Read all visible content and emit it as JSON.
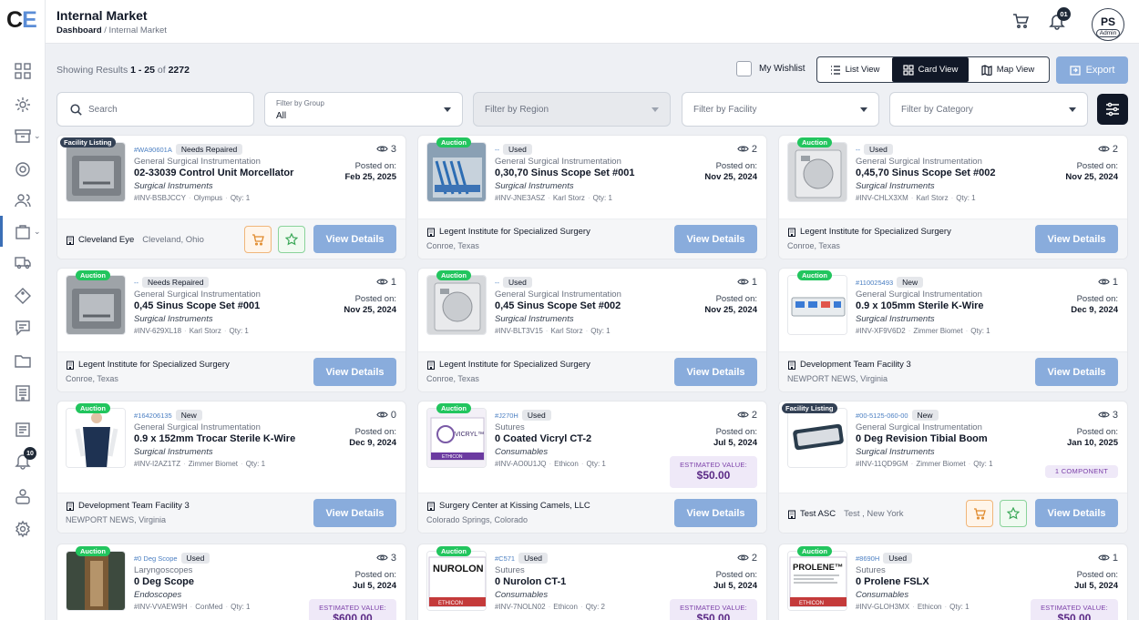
{
  "app": {
    "logo_c": "C",
    "logo_e": "E"
  },
  "header": {
    "title": "Internal Market",
    "breadcrumb_root": "Dashboard",
    "breadcrumb_sep": " / ",
    "breadcrumb_current": "Internal Market",
    "notifications": "01",
    "avatar_initials": "PS",
    "avatar_role": "Admin"
  },
  "sidebar": {
    "notification_badge": "10"
  },
  "toolbar": {
    "results_prefix": "Showing Results ",
    "results_range": "1 - 25",
    "results_of": " of ",
    "results_total": "2272",
    "wishlist_label": "My Wishlist",
    "views": [
      "List View",
      "Card View",
      "Map View"
    ],
    "active_view": "Card View",
    "export_label": "Export"
  },
  "filters": {
    "search_placeholder": "Search",
    "group_label": "Filter by Group",
    "group_value": "All",
    "region": "Filter by Region",
    "facility": "Filter by Facility",
    "category": "Filter by Category"
  },
  "labels": {
    "posted_on": "Posted on:",
    "view_details": "View Details",
    "estimated_value": "ESTIMATED VALUE:",
    "component": "1 COMPONENT",
    "qty_prefix": "Qty: "
  },
  "cards": [
    {
      "badge": "Facility Listing",
      "badge_type": "listing",
      "id": "#WA90601A",
      "condition": "Needs Repaired",
      "views": "3",
      "group": "General Surgical Instrumentation",
      "title": "02-33039 Control Unit Morcellator",
      "category": "Surgical Instruments",
      "inv": "#INV-BSBJCCY",
      "maker": "Olympus",
      "qty": "1",
      "posted": "Feb 25, 2025",
      "facility": "Cleveland Eye",
      "location": "Cleveland, Ohio",
      "location_inline": true,
      "actions": true,
      "thumb": "grey"
    },
    {
      "badge": "Auction",
      "badge_type": "auction",
      "id": "--",
      "condition": "Used",
      "views": "2",
      "group": "General Surgical Instrumentation",
      "title": "0,30,70 Sinus Scope Set #001",
      "category": "Surgical Instruments",
      "inv": "#INV-JNE3ASZ",
      "maker": "Karl Storz",
      "qty": "1",
      "posted": "Nov 25, 2024",
      "facility": "Legent Institute for Specialized Surgery",
      "location": "Conroe, Texas",
      "thumb": "blue"
    },
    {
      "badge": "Auction",
      "badge_type": "auction",
      "id": "--",
      "condition": "Used",
      "views": "2",
      "group": "General Surgical Instrumentation",
      "title": "0,45,70 Sinus Scope Set #002",
      "category": "Surgical Instruments",
      "inv": "#INV-CHLX3XM",
      "maker": "Karl Storz",
      "qty": "1",
      "posted": "Nov 25, 2024",
      "facility": "Legent Institute for Specialized Surgery",
      "location": "Conroe, Texas",
      "thumb": "silver"
    },
    {
      "badge": "Auction",
      "badge_type": "auction",
      "id": "--",
      "condition": "Needs Repaired",
      "views": "1",
      "group": "General Surgical Instrumentation",
      "title": "0,45 Sinus Scope Set #001",
      "category": "Surgical Instruments",
      "inv": "#INV-629XL18",
      "maker": "Karl Storz",
      "qty": "1",
      "posted": "Nov 25, 2024",
      "facility": "Legent Institute for Specialized Surgery",
      "location": "Conroe, Texas",
      "thumb": "grey"
    },
    {
      "badge": "Auction",
      "badge_type": "auction",
      "id": "--",
      "condition": "Used",
      "views": "1",
      "group": "General Surgical Instrumentation",
      "title": "0,45 Sinus Scope Set #002",
      "category": "Surgical Instruments",
      "inv": "#INV-BLT3V15",
      "maker": "Karl Storz",
      "qty": "1",
      "posted": "Nov 25, 2024",
      "facility": "Legent Institute for Specialized Surgery",
      "location": "Conroe, Texas",
      "thumb": "silver"
    },
    {
      "badge": "Auction",
      "badge_type": "auction",
      "id": "#110025493",
      "condition": "New",
      "views": "1",
      "group": "General Surgical Instrumentation",
      "title": "0.9 x 105mm Sterile K-Wire",
      "category": "Surgical Instruments",
      "inv": "#INV-XF9V6D2",
      "maker": "Zimmer Biomet",
      "qty": "1",
      "posted": "Dec 9, 2024",
      "facility": "Development Team Facility 3",
      "location": "NEWPORT NEWS, Virginia",
      "thumb": "device"
    },
    {
      "badge": "Auction",
      "badge_type": "auction",
      "id": "#164206135",
      "condition": "New",
      "views": "0",
      "group": "General Surgical Instrumentation",
      "title": "0.9 x 152mm Trocar Sterile K-Wire",
      "category": "Surgical Instruments",
      "inv": "#INV-I2AZ1TZ",
      "maker": "Zimmer Biomet",
      "qty": "1",
      "posted": "Dec 9, 2024",
      "facility": "Development Team Facility 3",
      "location": "NEWPORT NEWS, Virginia",
      "thumb": "person"
    },
    {
      "badge": "Auction",
      "badge_type": "auction",
      "id": "#J270H",
      "condition": "Used",
      "views": "2",
      "group": "Sutures",
      "title": "0 Coated Vicryl CT-2",
      "category": "Consumables",
      "inv": "#INV-AO0U1JQ",
      "maker": "Ethicon",
      "qty": "1",
      "posted": "Jul 5, 2024",
      "estimated": "$50.00",
      "facility": "Surgery Center at Kissing Camels, LLC",
      "location": "Colorado Springs, Colorado",
      "thumb": "vicryl"
    },
    {
      "badge": "Facility Listing",
      "badge_type": "listing",
      "id": "#00-5125-060-00",
      "condition": "New",
      "views": "3",
      "group": "General Surgical Instrumentation",
      "title": "0 Deg Revision Tibial Boom",
      "category": "Surgical Instruments",
      "inv": "#INV-11QD9GM",
      "maker": "Zimmer Biomet",
      "qty": "1",
      "posted": "Jan 10, 2025",
      "component": true,
      "facility": "Test ASC",
      "location": "Test , New York",
      "location_inline": true,
      "actions": true,
      "thumb": "tray"
    },
    {
      "badge": "Auction",
      "badge_type": "auction",
      "id": "#0 Deg Scope",
      "condition": "Used",
      "views": "3",
      "group": "Laryngoscopes",
      "title": "0 Deg Scope",
      "category": "Endoscopes",
      "inv": "#INV-VVAEW9H",
      "maker": "ConMed",
      "qty": "1",
      "posted": "Jul 5, 2024",
      "estimated": "$600.00",
      "facility": "",
      "location": "",
      "thumb": "scope"
    },
    {
      "badge": "Auction",
      "badge_type": "auction",
      "id": "#C571",
      "condition": "Used",
      "views": "2",
      "group": "Sutures",
      "title": "0 Nurolon CT-1",
      "category": "Consumables",
      "inv": "#INV-7NOLN02",
      "maker": "Ethicon",
      "qty": "2",
      "posted": "Jul 5, 2024",
      "estimated": "$50.00",
      "facility": "",
      "location": "",
      "thumb": "nurolon"
    },
    {
      "badge": "Auction",
      "badge_type": "auction",
      "id": "#8690H",
      "condition": "Used",
      "views": "1",
      "group": "Sutures",
      "title": "0 Prolene FSLX",
      "category": "Consumables",
      "inv": "#INV-GLOH3MX",
      "maker": "Ethicon",
      "qty": "1",
      "posted": "Jul 5, 2024",
      "estimated": "$50.00",
      "facility": "",
      "location": "",
      "thumb": "prolene"
    }
  ],
  "thumb_text": {
    "vicryl": "VICRYL™",
    "nurolon": "NUROLON",
    "prolene": "PROLENE™",
    "ethicon": "ETHICON"
  }
}
